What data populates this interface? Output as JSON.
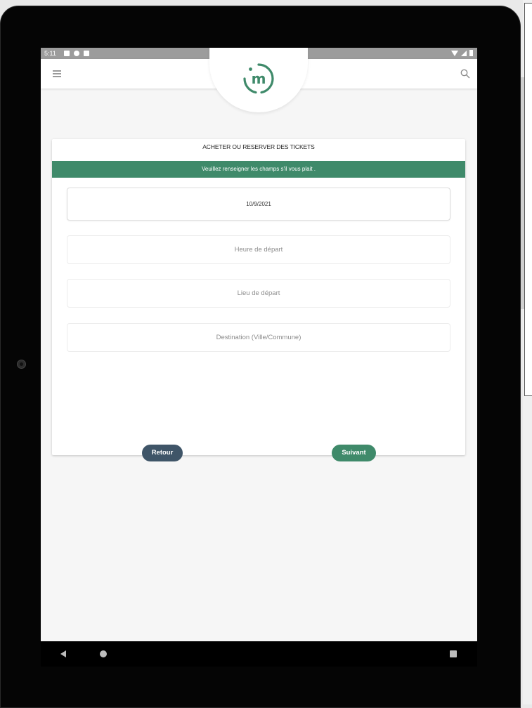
{
  "statusbar": {
    "time": "5:11"
  },
  "app": {
    "logo_text": "m",
    "brand_color": "#3f8a6a",
    "secondary_color": "#3f5568"
  },
  "card": {
    "title": "ACHETER OU RESERVER DES TICKETS",
    "banner": "Veuillez renseigner les champs s'il vous plait ."
  },
  "form": {
    "date_value": "10/9/2021",
    "departure_time_placeholder": "Heure de départ",
    "departure_place_placeholder": "Lieu de départ",
    "destination_placeholder": "Destination (Ville/Commune)"
  },
  "buttons": {
    "back_label": "Retour",
    "next_label": "Suivant"
  },
  "icons": {
    "menu": "menu-icon",
    "search": "search-icon",
    "nav_back": "nav-back-icon",
    "nav_home": "nav-home-icon",
    "nav_recent": "nav-recent-icon"
  }
}
